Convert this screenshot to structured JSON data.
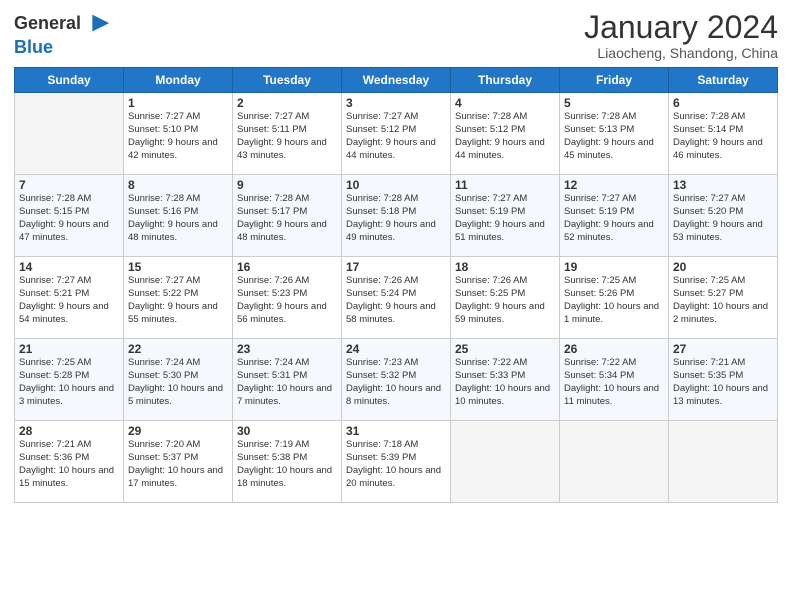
{
  "header": {
    "logo_line1": "General",
    "logo_line2": "Blue",
    "month_title": "January 2024",
    "subtitle": "Liaocheng, Shandong, China"
  },
  "weekdays": [
    "Sunday",
    "Monday",
    "Tuesday",
    "Wednesday",
    "Thursday",
    "Friday",
    "Saturday"
  ],
  "weeks": [
    [
      {
        "day": null,
        "sunrise": null,
        "sunset": null,
        "daylight": null
      },
      {
        "day": "1",
        "sunrise": "7:27 AM",
        "sunset": "5:10 PM",
        "daylight": "9 hours and 42 minutes."
      },
      {
        "day": "2",
        "sunrise": "7:27 AM",
        "sunset": "5:11 PM",
        "daylight": "9 hours and 43 minutes."
      },
      {
        "day": "3",
        "sunrise": "7:27 AM",
        "sunset": "5:12 PM",
        "daylight": "9 hours and 44 minutes."
      },
      {
        "day": "4",
        "sunrise": "7:28 AM",
        "sunset": "5:12 PM",
        "daylight": "9 hours and 44 minutes."
      },
      {
        "day": "5",
        "sunrise": "7:28 AM",
        "sunset": "5:13 PM",
        "daylight": "9 hours and 45 minutes."
      },
      {
        "day": "6",
        "sunrise": "7:28 AM",
        "sunset": "5:14 PM",
        "daylight": "9 hours and 46 minutes."
      }
    ],
    [
      {
        "day": "7",
        "sunrise": "7:28 AM",
        "sunset": "5:15 PM",
        "daylight": "9 hours and 47 minutes."
      },
      {
        "day": "8",
        "sunrise": "7:28 AM",
        "sunset": "5:16 PM",
        "daylight": "9 hours and 48 minutes."
      },
      {
        "day": "9",
        "sunrise": "7:28 AM",
        "sunset": "5:17 PM",
        "daylight": "9 hours and 48 minutes."
      },
      {
        "day": "10",
        "sunrise": "7:28 AM",
        "sunset": "5:18 PM",
        "daylight": "9 hours and 49 minutes."
      },
      {
        "day": "11",
        "sunrise": "7:27 AM",
        "sunset": "5:19 PM",
        "daylight": "9 hours and 51 minutes."
      },
      {
        "day": "12",
        "sunrise": "7:27 AM",
        "sunset": "5:19 PM",
        "daylight": "9 hours and 52 minutes."
      },
      {
        "day": "13",
        "sunrise": "7:27 AM",
        "sunset": "5:20 PM",
        "daylight": "9 hours and 53 minutes."
      }
    ],
    [
      {
        "day": "14",
        "sunrise": "7:27 AM",
        "sunset": "5:21 PM",
        "daylight": "9 hours and 54 minutes."
      },
      {
        "day": "15",
        "sunrise": "7:27 AM",
        "sunset": "5:22 PM",
        "daylight": "9 hours and 55 minutes."
      },
      {
        "day": "16",
        "sunrise": "7:26 AM",
        "sunset": "5:23 PM",
        "daylight": "9 hours and 56 minutes."
      },
      {
        "day": "17",
        "sunrise": "7:26 AM",
        "sunset": "5:24 PM",
        "daylight": "9 hours and 58 minutes."
      },
      {
        "day": "18",
        "sunrise": "7:26 AM",
        "sunset": "5:25 PM",
        "daylight": "9 hours and 59 minutes."
      },
      {
        "day": "19",
        "sunrise": "7:25 AM",
        "sunset": "5:26 PM",
        "daylight": "10 hours and 1 minute."
      },
      {
        "day": "20",
        "sunrise": "7:25 AM",
        "sunset": "5:27 PM",
        "daylight": "10 hours and 2 minutes."
      }
    ],
    [
      {
        "day": "21",
        "sunrise": "7:25 AM",
        "sunset": "5:28 PM",
        "daylight": "10 hours and 3 minutes."
      },
      {
        "day": "22",
        "sunrise": "7:24 AM",
        "sunset": "5:30 PM",
        "daylight": "10 hours and 5 minutes."
      },
      {
        "day": "23",
        "sunrise": "7:24 AM",
        "sunset": "5:31 PM",
        "daylight": "10 hours and 7 minutes."
      },
      {
        "day": "24",
        "sunrise": "7:23 AM",
        "sunset": "5:32 PM",
        "daylight": "10 hours and 8 minutes."
      },
      {
        "day": "25",
        "sunrise": "7:22 AM",
        "sunset": "5:33 PM",
        "daylight": "10 hours and 10 minutes."
      },
      {
        "day": "26",
        "sunrise": "7:22 AM",
        "sunset": "5:34 PM",
        "daylight": "10 hours and 11 minutes."
      },
      {
        "day": "27",
        "sunrise": "7:21 AM",
        "sunset": "5:35 PM",
        "daylight": "10 hours and 13 minutes."
      }
    ],
    [
      {
        "day": "28",
        "sunrise": "7:21 AM",
        "sunset": "5:36 PM",
        "daylight": "10 hours and 15 minutes."
      },
      {
        "day": "29",
        "sunrise": "7:20 AM",
        "sunset": "5:37 PM",
        "daylight": "10 hours and 17 minutes."
      },
      {
        "day": "30",
        "sunrise": "7:19 AM",
        "sunset": "5:38 PM",
        "daylight": "10 hours and 18 minutes."
      },
      {
        "day": "31",
        "sunrise": "7:18 AM",
        "sunset": "5:39 PM",
        "daylight": "10 hours and 20 minutes."
      },
      {
        "day": null,
        "sunrise": null,
        "sunset": null,
        "daylight": null
      },
      {
        "day": null,
        "sunrise": null,
        "sunset": null,
        "daylight": null
      },
      {
        "day": null,
        "sunrise": null,
        "sunset": null,
        "daylight": null
      }
    ]
  ],
  "labels": {
    "sunrise": "Sunrise:",
    "sunset": "Sunset:",
    "daylight": "Daylight:"
  }
}
